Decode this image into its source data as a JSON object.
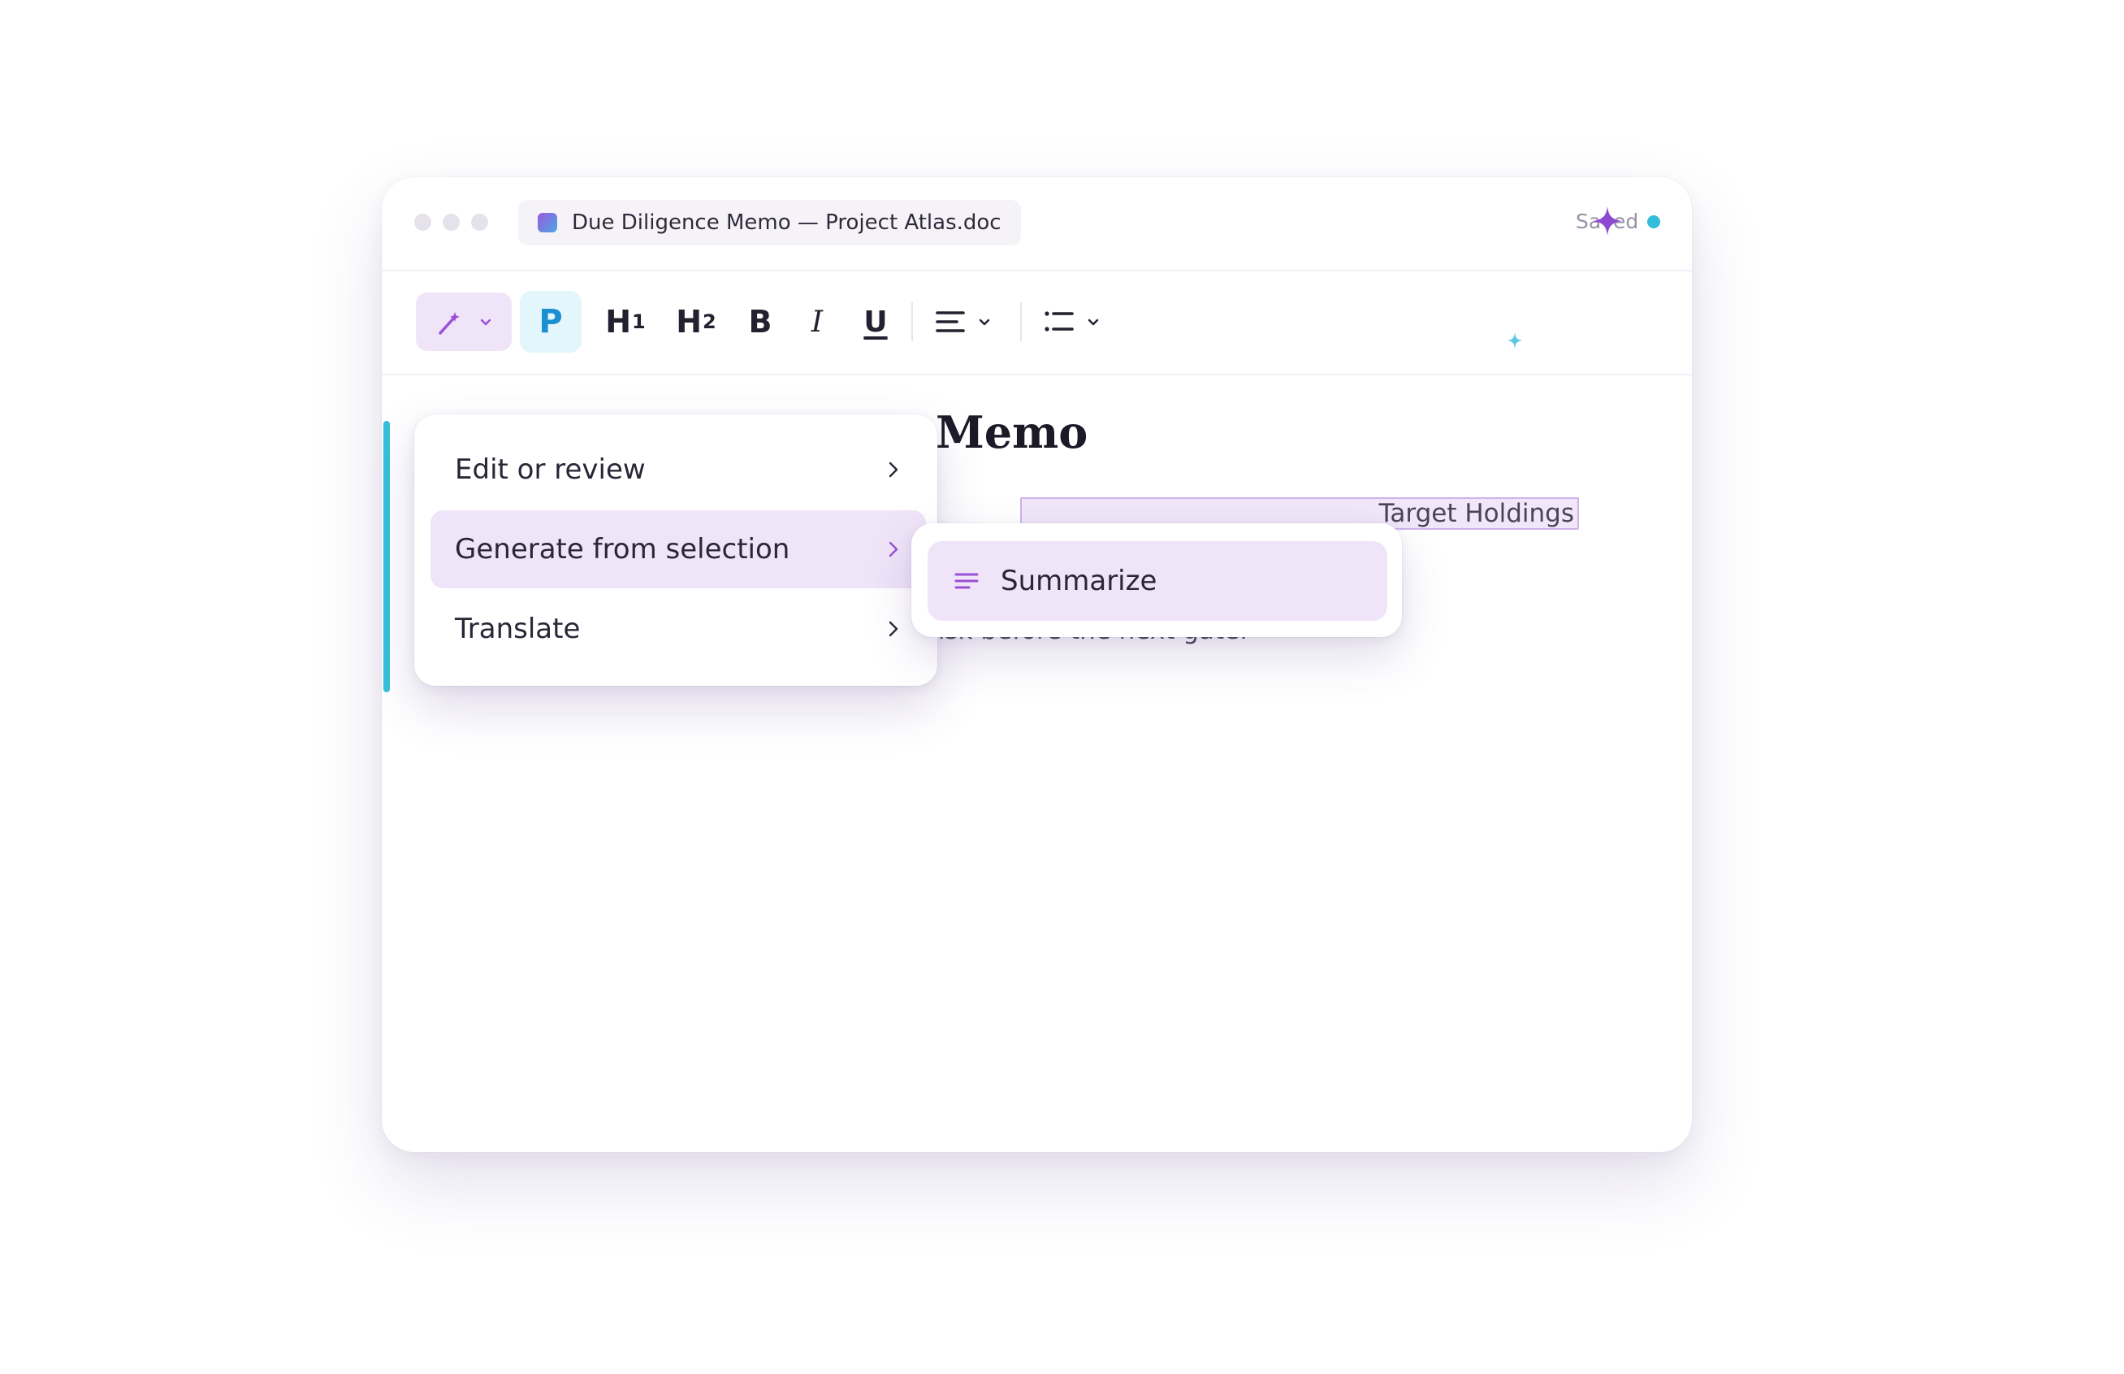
{
  "window": {
    "doc_title": "Due Diligence Memo — Project Atlas.doc",
    "status_text": "Saved"
  },
  "toolbar": {
    "ai_tool": "magic-wand-icon",
    "paragraph_label": "P",
    "h1_label": "H",
    "h1_sub": "1",
    "h2_label": "H",
    "h2_sub": "2",
    "bold_label": "B",
    "italic_label": "I",
    "underline_label": "U"
  },
  "document": {
    "heading_visible": "Memo",
    "line1_visible": "Target Holdings",
    "line2_visible": "risk before the next gate."
  },
  "menu": {
    "items": [
      {
        "label": "Edit or review",
        "active": false
      },
      {
        "label": "Generate from selection",
        "active": true
      },
      {
        "label": "Translate",
        "active": false
      }
    ]
  },
  "submenu": {
    "items": [
      {
        "label": "Summarize",
        "icon": "lines-icon"
      }
    ]
  },
  "colors": {
    "accent_purple": "#9b59d9",
    "accent_cyan": "#36bfd9",
    "menu_active_bg": "#efe4f8",
    "paragraph_blue": "#1b8fd1"
  }
}
